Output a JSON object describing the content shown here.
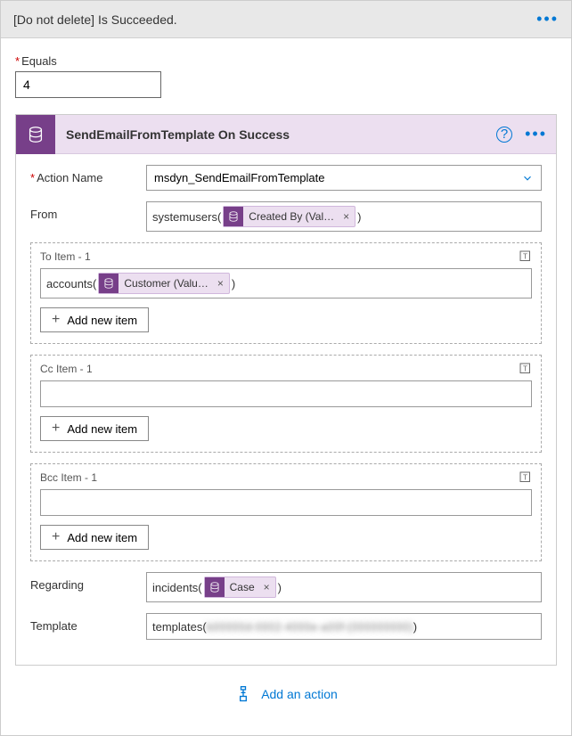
{
  "header": {
    "title": "[Do not delete] Is Succeeded."
  },
  "equals": {
    "label": "Equals",
    "value": "4"
  },
  "card": {
    "title": "SendEmailFromTemplate On Success",
    "fields": {
      "action_name": {
        "label": "Action Name",
        "value": "msdyn_SendEmailFromTemplate"
      },
      "from": {
        "label": "From",
        "prefix": "systemusers(",
        "token": "Created By (Val…",
        "suffix": ")"
      },
      "to": {
        "label": "To Item - 1",
        "prefix": "accounts(",
        "token": "Customer (Valu…",
        "suffix": ")",
        "add": "Add new item"
      },
      "cc": {
        "label": "Cc Item - 1",
        "add": "Add new item"
      },
      "bcc": {
        "label": "Bcc Item - 1",
        "add": "Add new item"
      },
      "regarding": {
        "label": "Regarding",
        "prefix": "incidents(",
        "token": "Case",
        "suffix": ")"
      },
      "template": {
        "label": "Template",
        "prefix": "templates(",
        "masked": "b00000d-0002-4000e-a00f-(000000000)",
        "suffix": ")"
      }
    }
  },
  "footer": {
    "add_action": "Add an action"
  }
}
